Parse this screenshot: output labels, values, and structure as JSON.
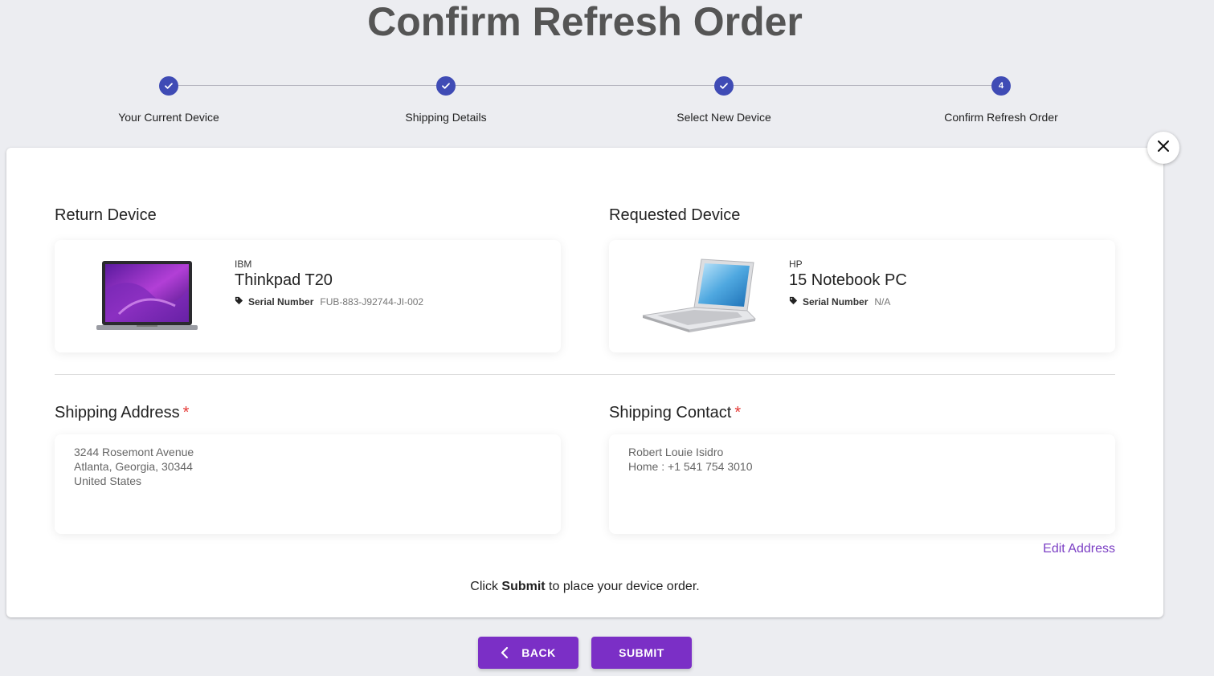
{
  "page_title": "Confirm Refresh Order",
  "stepper": {
    "steps": [
      {
        "label": "Your Current Device",
        "state": "complete"
      },
      {
        "label": "Shipping Details",
        "state": "complete"
      },
      {
        "label": "Select New Device",
        "state": "complete"
      },
      {
        "label": "Confirm Refresh Order",
        "state": "active",
        "number": "4"
      }
    ],
    "accent_color": "#3f4bb5"
  },
  "return_device": {
    "heading": "Return Device",
    "brand": "IBM",
    "model": "Thinkpad T20",
    "serial_label": "Serial Number",
    "serial_value": "FUB-883-J92744-JI-002"
  },
  "requested_device": {
    "heading": "Requested Device",
    "brand": "HP",
    "model": "15 Notebook PC",
    "serial_label": "Serial Number",
    "serial_value": "N/A"
  },
  "shipping_address": {
    "heading": "Shipping Address",
    "required_mark": "*",
    "lines": [
      "3244 Rosemont Avenue",
      "Atlanta, Georgia, 30344",
      "United States"
    ]
  },
  "shipping_contact": {
    "heading": "Shipping Contact",
    "required_mark": "*",
    "lines": [
      "Robert Louie Isidro",
      "Home : +1 541 754 3010"
    ]
  },
  "edit_address_label": "Edit Address",
  "instruction": {
    "prefix": "Click ",
    "bold": "Submit",
    "suffix": " to place your device order."
  },
  "buttons": {
    "back_label": "BACK",
    "submit_label": "SUBMIT",
    "color": "#7b2fc6"
  },
  "icons": {
    "close": "close-icon",
    "back": "chevron-left-icon",
    "tag": "tag-icon",
    "check": "check-icon"
  }
}
